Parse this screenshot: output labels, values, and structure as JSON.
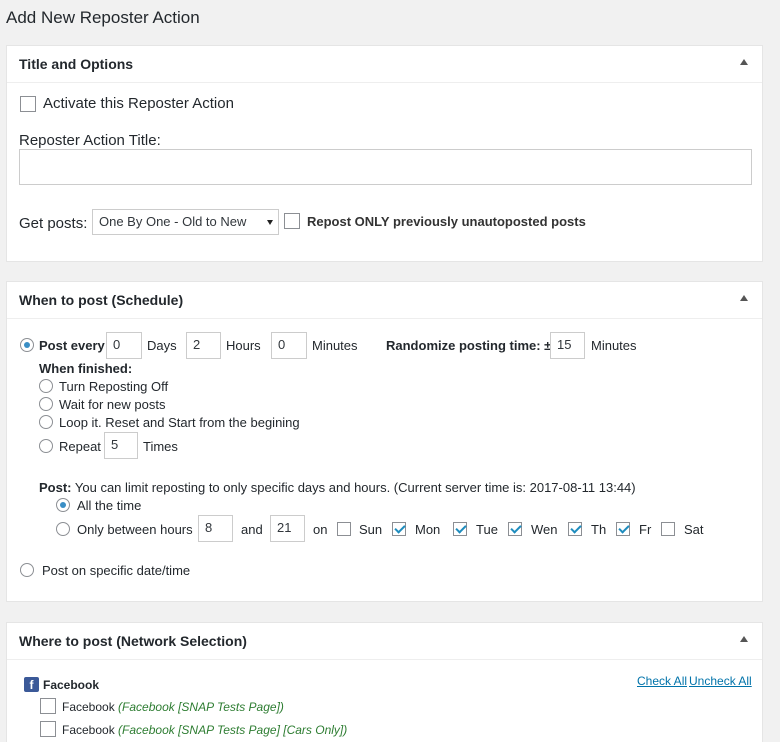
{
  "page_title": "Add New Reposter Action",
  "title_box": {
    "heading": "Title and Options",
    "activate_label": "Activate this Reposter Action",
    "title_label": "Reposter Action Title:",
    "title_value": "",
    "get_posts_label": "Get posts:",
    "get_posts_selected": "One By One - Old to New",
    "repost_only_label": "Repost ONLY previously unautoposted posts"
  },
  "schedule_box": {
    "heading": "When to post (Schedule)",
    "post_every_label": "Post every:",
    "days_value": "0",
    "days_label": "Days",
    "hours_value": "2",
    "hours_label": "Hours",
    "minutes_value": "0",
    "minutes_label": "Minutes",
    "randomize_label": "Randomize posting time: ±",
    "randomize_value": "15",
    "randomize_unit": "Minutes",
    "when_finished_label": "When finished:",
    "finish_options": [
      "Turn Reposting Off",
      "Wait for new posts",
      "Loop it. Reset and Start from the begining"
    ],
    "repeat_label": "Repeat",
    "repeat_value": "5",
    "times_label": "Times",
    "post_prefix": "Post:",
    "post_note": "You can limit reposting to only specific days and hours. (Current server time is: 2017-08-11 13:44)",
    "all_time_label": "All the time",
    "only_between_label": "Only between hours",
    "from_hour": "8",
    "and_label": "and",
    "to_hour": "21",
    "on_label": "on",
    "days": [
      {
        "label": "Sun",
        "checked": false
      },
      {
        "label": "Mon",
        "checked": true
      },
      {
        "label": "Tue",
        "checked": true
      },
      {
        "label": "Wen",
        "checked": true
      },
      {
        "label": "Th",
        "checked": true
      },
      {
        "label": "Fr",
        "checked": true
      },
      {
        "label": "Sat",
        "checked": false
      }
    ],
    "specific_date_label": "Post on specific date/time"
  },
  "network_box": {
    "heading": "Where to post (Network Selection)",
    "network_name": "Facebook",
    "check_all": "Check All",
    "uncheck_all": "Uncheck All",
    "accounts": [
      {
        "name": "Facebook",
        "detail": "(Facebook [SNAP Tests Page])"
      },
      {
        "name": "Facebook",
        "detail": "(Facebook [SNAP Tests Page] [Cars Only])"
      }
    ]
  }
}
